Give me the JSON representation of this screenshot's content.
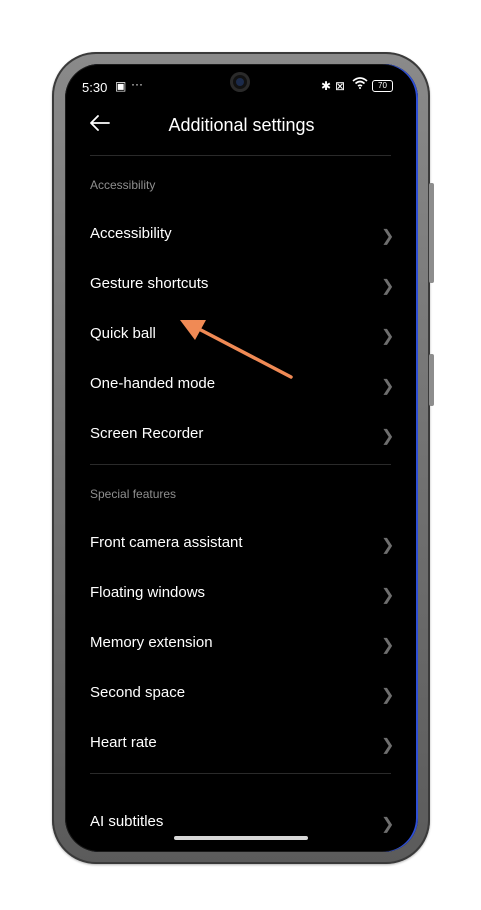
{
  "status": {
    "time": "5:30",
    "left_icons": [
      "image-icon",
      "more-dots-icon"
    ],
    "right_icons": [
      "bluetooth-icon",
      "no-sim-icon",
      "wifi-icon"
    ],
    "battery": "70"
  },
  "header": {
    "title": "Additional settings",
    "back_icon": "back-arrow-icon"
  },
  "sections": [
    {
      "label": "Accessibility",
      "items": [
        {
          "label": "Accessibility"
        },
        {
          "label": "Gesture shortcuts"
        },
        {
          "label": "Quick ball"
        },
        {
          "label": "One-handed mode"
        },
        {
          "label": "Screen Recorder"
        }
      ]
    },
    {
      "label": "Special features",
      "items": [
        {
          "label": "Front camera assistant"
        },
        {
          "label": "Floating windows"
        },
        {
          "label": "Memory extension"
        },
        {
          "label": "Second space"
        },
        {
          "label": "Heart rate"
        }
      ]
    },
    {
      "label": "",
      "items": [
        {
          "label": "AI subtitles"
        }
      ]
    }
  ],
  "annotation": {
    "color": "#f08a55",
    "target": "Quick ball"
  },
  "colors": {
    "screen_bg": "#000000",
    "text": "#ffffff",
    "section_label": "#8f8f8f",
    "accent_edge": "#2e4fd6"
  }
}
